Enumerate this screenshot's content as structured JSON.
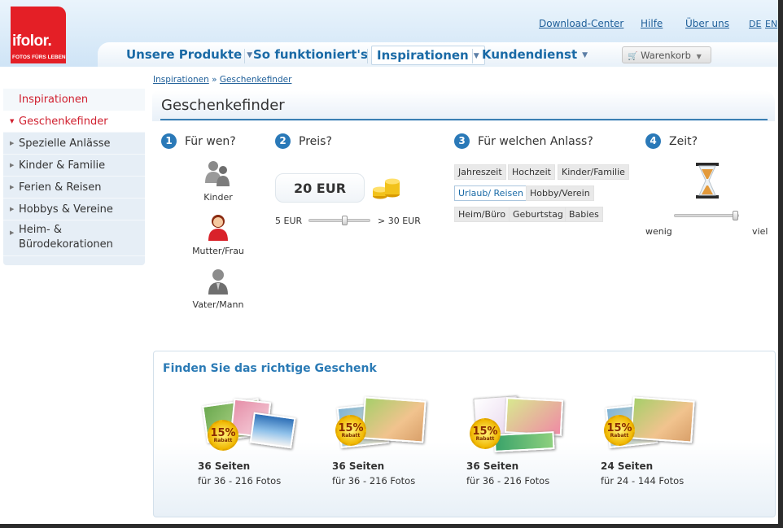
{
  "header": {
    "logo_text": "ifolor.",
    "logo_tagline": "FOTOS FÜRS LEBEN",
    "toplinks": [
      "Download-Center",
      "Hilfe",
      "Über uns"
    ],
    "languages": [
      "DE",
      "EN"
    ],
    "nav": [
      {
        "label": "Unsere Produkte"
      },
      {
        "label": "So funktioniert's"
      },
      {
        "label": "Inspirationen"
      },
      {
        "label": "Kundendienst"
      }
    ],
    "cart_label": "Warenkorb"
  },
  "sidebar": {
    "heading": "Inspirationen",
    "items": [
      {
        "label": "Geschenkefinder"
      },
      {
        "label": "Spezielle Anlässe"
      },
      {
        "label": "Kinder & Familie"
      },
      {
        "label": "Ferien & Reisen"
      },
      {
        "label": "Hobbys & Vereine"
      },
      {
        "label": "Heim- & Bürodekorationen",
        "line1": "Heim- &",
        "line2": "Bürodekorationen"
      }
    ]
  },
  "breadcrumb": {
    "parent": "Inspirationen",
    "separator": "»",
    "current": "Geschenkefinder"
  },
  "finder": {
    "title": "Geschenkefinder",
    "steps": [
      {
        "num": "1",
        "label": "Für wen?"
      },
      {
        "num": "2",
        "label": "Preis?"
      },
      {
        "num": "3",
        "label": "Für welchen Anlass?"
      },
      {
        "num": "4",
        "label": "Zeit?"
      }
    ],
    "recipients": [
      {
        "label": "Kinder",
        "icon": "children-icon"
      },
      {
        "label": "Mutter/Frau",
        "icon": "woman-icon"
      },
      {
        "label": "Vater/Mann",
        "icon": "man-icon"
      }
    ],
    "price": {
      "value": "20 EUR",
      "min_label": "5 EUR",
      "max_label": "> 30 EUR",
      "level": 0.6
    },
    "occasions": [
      {
        "label": "Jahreszeit",
        "selected": false
      },
      {
        "label": "Hochzeit",
        "selected": false
      },
      {
        "label": "Kinder/Familie",
        "selected": false
      },
      {
        "label": "Urlaub/ Reisen",
        "selected": true
      },
      {
        "label": "Hobby/Verein",
        "selected": false
      },
      {
        "label": "Heim/Büro",
        "selected": false
      },
      {
        "label": "Geburtstag",
        "selected": false
      },
      {
        "label": "Babies",
        "selected": false
      }
    ],
    "time": {
      "min_label": "wenig",
      "max_label": "viel",
      "level": 1.0
    }
  },
  "results": {
    "title": "Finden Sie das richtige Geschenk",
    "products": [
      {
        "title": "36 Seiten",
        "subtitle": "für 36 - 216 Fotos",
        "badge": "15%",
        "badge_sub": "Rabatt"
      },
      {
        "title": "36 Seiten",
        "subtitle": "für 36 - 216 Fotos",
        "badge": "15%",
        "badge_sub": "Rabatt"
      },
      {
        "title": "36 Seiten",
        "subtitle": "für 36 - 216 Fotos",
        "badge": "15%",
        "badge_sub": "Rabatt"
      },
      {
        "title": "24 Seiten",
        "subtitle": "für 24 - 144 Fotos",
        "badge": "15%",
        "badge_sub": "Rabatt"
      }
    ]
  },
  "colors": {
    "brand_red": "#e41f26",
    "link_blue": "#1f5f99",
    "accent_blue": "#2a79b8"
  }
}
